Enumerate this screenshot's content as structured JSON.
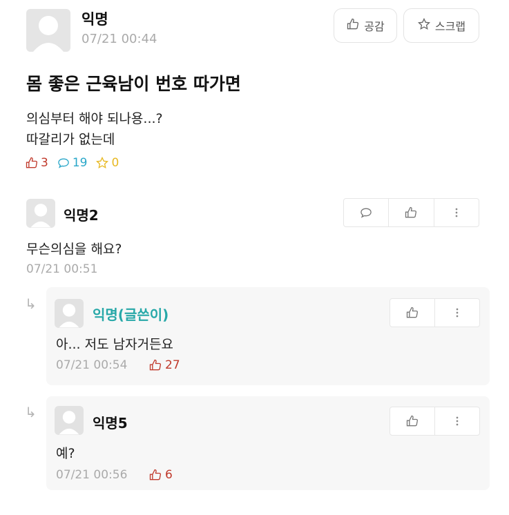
{
  "post": {
    "author": "익명",
    "time": "07/21 00:44",
    "title": "몸 좋은 근육남이 번호 따가면",
    "body_line1": "의심부터 해야 되나용...?",
    "body_line2": "따갈리가 없는데",
    "likes": "3",
    "comments": "19",
    "scraps": "0",
    "like_button_label": "공감",
    "scrap_button_label": "스크랩"
  },
  "comments": [
    {
      "author": "익명2",
      "text": "무슨의심을 해요?",
      "time": "07/21 00:51"
    },
    {
      "author": "익명(글쓴이)",
      "text": "아... 저도 남자거든요",
      "time": "07/21 00:54",
      "likes": "27"
    },
    {
      "author": "익명5",
      "text": "예?",
      "time": "07/21 00:56",
      "likes": "6"
    }
  ],
  "colors": {
    "like": "#c0392b",
    "comment": "#2aa7c9",
    "scrap": "#e8b923",
    "op_name": "#27a8a8"
  }
}
